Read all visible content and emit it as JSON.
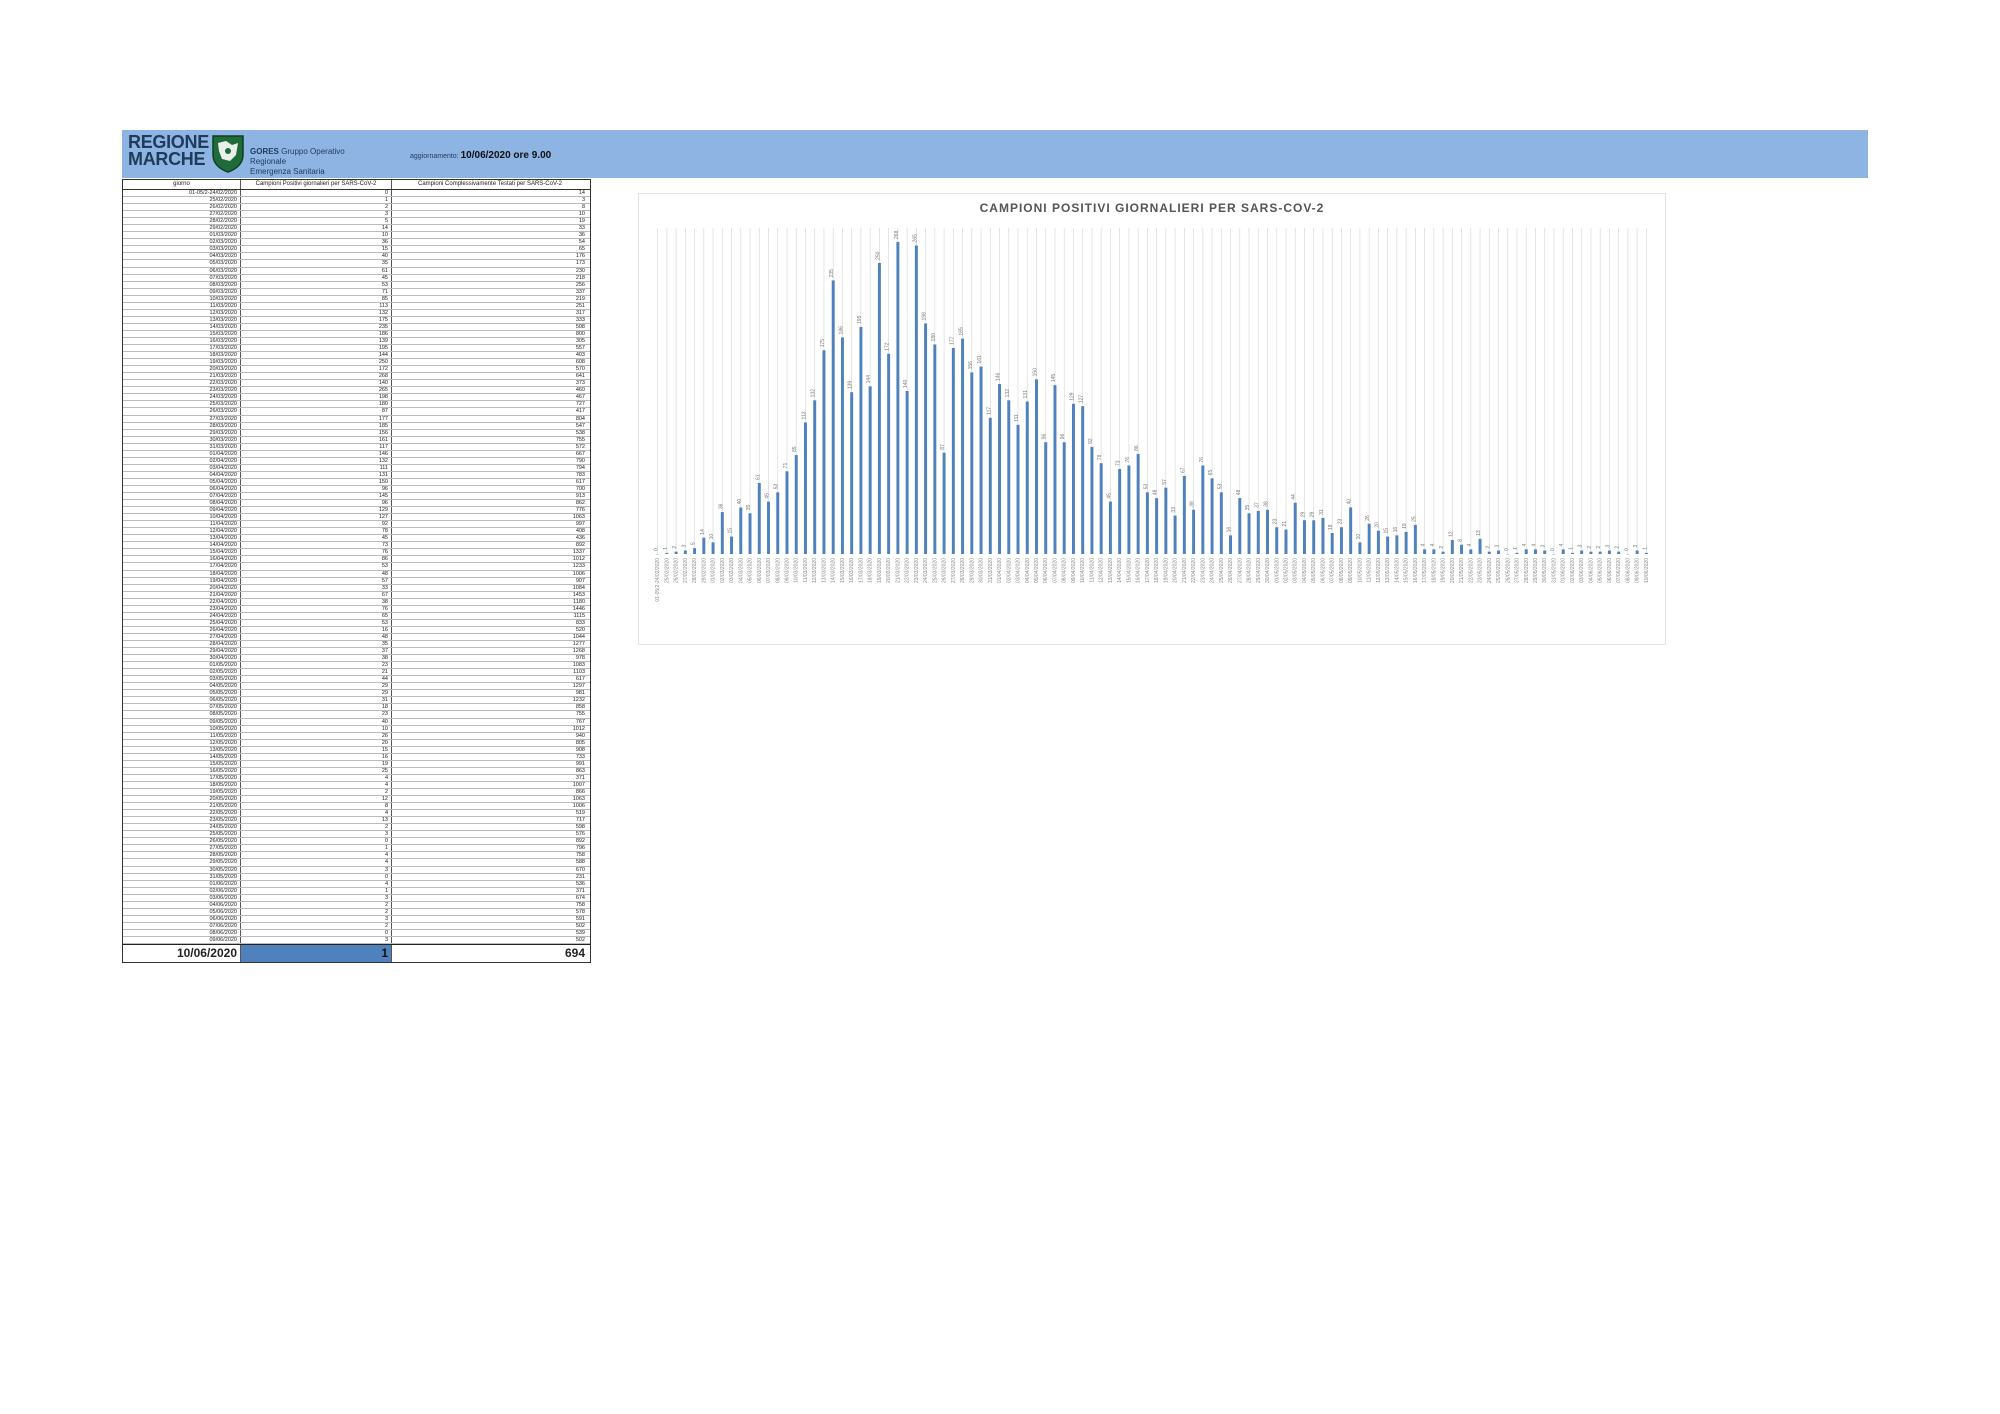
{
  "header": {
    "logo_text_line1": "REGIONE",
    "logo_text_line2": "MARCHE",
    "org_name": "GORES",
    "org_desc1": "Gruppo Operativo Regionale",
    "org_desc2": "Emergenza Sanitaria",
    "update_label": "aggiornamento:",
    "update_value": "10/06/2020 ore 9.00"
  },
  "table": {
    "headers": [
      "giorno",
      "Campioni Positivi giornalieri per SARS-CoV-2",
      "Campioni Complessivamente Testati per SARS-CoV-2"
    ],
    "rows": [
      [
        "01-05/2-24/02/2020",
        "0",
        "14"
      ],
      [
        "25/02/2020",
        "1",
        "3"
      ],
      [
        "26/02/2020",
        "2",
        "8"
      ],
      [
        "27/02/2020",
        "3",
        "10"
      ],
      [
        "28/02/2020",
        "5",
        "19"
      ],
      [
        "29/02/2020",
        "14",
        "33"
      ],
      [
        "01/03/2020",
        "10",
        "36"
      ],
      [
        "02/03/2020",
        "36",
        "54"
      ],
      [
        "03/03/2020",
        "15",
        "65"
      ],
      [
        "04/03/2020",
        "40",
        "176"
      ],
      [
        "05/03/2020",
        "35",
        "173"
      ],
      [
        "06/03/2020",
        "61",
        "230"
      ],
      [
        "07/03/2020",
        "45",
        "218"
      ],
      [
        "08/03/2020",
        "53",
        "256"
      ],
      [
        "09/03/2020",
        "71",
        "337"
      ],
      [
        "10/03/2020",
        "85",
        "219"
      ],
      [
        "11/03/2020",
        "113",
        "251"
      ],
      [
        "12/03/2020",
        "132",
        "317"
      ],
      [
        "13/03/2020",
        "175",
        "333"
      ],
      [
        "14/03/2020",
        "235",
        "508"
      ],
      [
        "15/03/2020",
        "186",
        "800"
      ],
      [
        "16/03/2020",
        "139",
        "305"
      ],
      [
        "17/03/2020",
        "195",
        "557"
      ],
      [
        "18/03/2020",
        "144",
        "403"
      ],
      [
        "19/03/2020",
        "250",
        "608"
      ],
      [
        "20/03/2020",
        "172",
        "570"
      ],
      [
        "21/03/2020",
        "268",
        "641"
      ],
      [
        "22/03/2020",
        "140",
        "373"
      ],
      [
        "23/03/2020",
        "265",
        "460"
      ],
      [
        "24/03/2020",
        "198",
        "467"
      ],
      [
        "25/03/2020",
        "180",
        "727"
      ],
      [
        "26/03/2020",
        "87",
        "417"
      ],
      [
        "27/03/2020",
        "177",
        "804"
      ],
      [
        "28/03/2020",
        "185",
        "547"
      ],
      [
        "29/03/2020",
        "156",
        "538"
      ],
      [
        "30/03/2020",
        "161",
        "755"
      ],
      [
        "31/03/2020",
        "117",
        "572"
      ],
      [
        "01/04/2020",
        "146",
        "667"
      ],
      [
        "02/04/2020",
        "132",
        "790"
      ],
      [
        "03/04/2020",
        "111",
        "794"
      ],
      [
        "04/04/2020",
        "131",
        "783"
      ],
      [
        "05/04/2020",
        "150",
        "617"
      ],
      [
        "06/04/2020",
        "96",
        "700"
      ],
      [
        "07/04/2020",
        "145",
        "913"
      ],
      [
        "08/04/2020",
        "96",
        "862"
      ],
      [
        "09/04/2020",
        "129",
        "776"
      ],
      [
        "10/04/2020",
        "127",
        "1063"
      ],
      [
        "11/04/2020",
        "92",
        "997"
      ],
      [
        "12/04/2020",
        "78",
        "408"
      ],
      [
        "13/04/2020",
        "45",
        "436"
      ],
      [
        "14/04/2020",
        "73",
        "892"
      ],
      [
        "15/04/2020",
        "76",
        "1337"
      ],
      [
        "16/04/2020",
        "86",
        "1012"
      ],
      [
        "17/04/2020",
        "53",
        "1233"
      ],
      [
        "18/04/2020",
        "48",
        "1006"
      ],
      [
        "19/04/2020",
        "57",
        "907"
      ],
      [
        "20/04/2020",
        "33",
        "1084"
      ],
      [
        "21/04/2020",
        "67",
        "1453"
      ],
      [
        "22/04/2020",
        "38",
        "1180"
      ],
      [
        "23/04/2020",
        "76",
        "1446"
      ],
      [
        "24/04/2020",
        "65",
        "1115"
      ],
      [
        "25/04/2020",
        "53",
        "833"
      ],
      [
        "26/04/2020",
        "16",
        "520"
      ],
      [
        "27/04/2020",
        "48",
        "1044"
      ],
      [
        "28/04/2020",
        "35",
        "1277"
      ],
      [
        "29/04/2020",
        "37",
        "1268"
      ],
      [
        "30/04/2020",
        "38",
        "978"
      ],
      [
        "01/05/2020",
        "23",
        "1083"
      ],
      [
        "02/05/2020",
        "21",
        "1103"
      ],
      [
        "03/05/2020",
        "44",
        "617"
      ],
      [
        "04/05/2020",
        "29",
        "1297"
      ],
      [
        "05/05/2020",
        "29",
        "981"
      ],
      [
        "06/05/2020",
        "31",
        "1232"
      ],
      [
        "07/05/2020",
        "18",
        "858"
      ],
      [
        "08/05/2020",
        "23",
        "755"
      ],
      [
        "09/05/2020",
        "40",
        "767"
      ],
      [
        "10/05/2020",
        "10",
        "1012"
      ],
      [
        "11/05/2020",
        "26",
        "940"
      ],
      [
        "12/05/2020",
        "20",
        "805"
      ],
      [
        "13/05/2020",
        "15",
        "908"
      ],
      [
        "14/05/2020",
        "16",
        "733"
      ],
      [
        "15/05/2020",
        "19",
        "991"
      ],
      [
        "16/05/2020",
        "25",
        "863"
      ],
      [
        "17/05/2020",
        "4",
        "371"
      ],
      [
        "18/05/2020",
        "4",
        "1007"
      ],
      [
        "19/05/2020",
        "2",
        "866"
      ],
      [
        "20/05/2020",
        "12",
        "1063"
      ],
      [
        "21/05/2020",
        "8",
        "1006"
      ],
      [
        "22/05/2020",
        "4",
        "519"
      ],
      [
        "23/05/2020",
        "13",
        "717"
      ],
      [
        "24/05/2020",
        "2",
        "598"
      ],
      [
        "25/05/2020",
        "3",
        "576"
      ],
      [
        "26/05/2020",
        "0",
        "892"
      ],
      [
        "27/05/2020",
        "1",
        "796"
      ],
      [
        "28/05/2020",
        "4",
        "758"
      ],
      [
        "29/05/2020",
        "4",
        "588"
      ],
      [
        "30/05/2020",
        "3",
        "670"
      ],
      [
        "31/05/2020",
        "0",
        "231"
      ],
      [
        "01/06/2020",
        "4",
        "536"
      ],
      [
        "02/06/2020",
        "1",
        "371"
      ],
      [
        "03/06/2020",
        "3",
        "674"
      ],
      [
        "04/06/2020",
        "2",
        "758"
      ],
      [
        "05/06/2020",
        "2",
        "578"
      ],
      [
        "06/06/2020",
        "3",
        "591"
      ],
      [
        "07/06/2020",
        "2",
        "502"
      ],
      [
        "08/06/2020",
        "0",
        "539"
      ],
      [
        "09/06/2020",
        "3",
        "502"
      ]
    ],
    "total_date": "10/06/2020",
    "total_positive": "1",
    "total_tested": "694"
  },
  "chart_data": {
    "type": "bar",
    "title": "CAMPIONI POSITIVI GIORNALIERI PER SARS-COV-2",
    "xlabel": "",
    "ylabel": "",
    "grid": "vertical",
    "color": "#4f81bd",
    "categories": [
      "01-05/2-24/02/2020",
      "25/02/2020",
      "26/02/2020",
      "27/02/2020",
      "28/02/2020",
      "29/02/2020",
      "01/03/2020",
      "02/03/2020",
      "03/03/2020",
      "04/03/2020",
      "05/03/2020",
      "06/03/2020",
      "07/03/2020",
      "08/03/2020",
      "09/03/2020",
      "10/03/2020",
      "11/03/2020",
      "12/03/2020",
      "13/03/2020",
      "14/03/2020",
      "15/03/2020",
      "16/03/2020",
      "17/03/2020",
      "18/03/2020",
      "19/03/2020",
      "20/03/2020",
      "21/03/2020",
      "22/03/2020",
      "23/03/2020",
      "24/03/2020",
      "25/03/2020",
      "26/03/2020",
      "27/03/2020",
      "28/03/2020",
      "29/03/2020",
      "30/03/2020",
      "31/03/2020",
      "01/04/2020",
      "02/04/2020",
      "03/04/2020",
      "04/04/2020",
      "05/04/2020",
      "06/04/2020",
      "07/04/2020",
      "08/04/2020",
      "09/04/2020",
      "10/04/2020",
      "11/04/2020",
      "12/04/2020",
      "13/04/2020",
      "14/04/2020",
      "15/04/2020",
      "16/04/2020",
      "17/04/2020",
      "18/04/2020",
      "19/04/2020",
      "20/04/2020",
      "21/04/2020",
      "22/04/2020",
      "23/04/2020",
      "24/04/2020",
      "25/04/2020",
      "26/04/2020",
      "27/04/2020",
      "28/04/2020",
      "29/04/2020",
      "30/04/2020",
      "01/05/2020",
      "02/05/2020",
      "03/05/2020",
      "04/05/2020",
      "05/05/2020",
      "06/05/2020",
      "07/05/2020",
      "08/05/2020",
      "09/05/2020",
      "10/05/2020",
      "11/05/2020",
      "12/05/2020",
      "13/05/2020",
      "14/05/2020",
      "15/05/2020",
      "16/05/2020",
      "17/05/2020",
      "18/05/2020",
      "19/05/2020",
      "20/05/2020",
      "21/05/2020",
      "22/05/2020",
      "23/05/2020",
      "24/05/2020",
      "25/05/2020",
      "26/05/2020",
      "27/05/2020",
      "28/05/2020",
      "29/05/2020",
      "30/05/2020",
      "31/05/2020",
      "01/06/2020",
      "02/06/2020",
      "03/06/2020",
      "04/06/2020",
      "05/06/2020",
      "06/06/2020",
      "07/06/2020",
      "08/06/2020",
      "09/06/2020",
      "10/06/2020"
    ],
    "values": [
      0,
      1,
      2,
      3,
      5,
      14,
      10,
      36,
      15,
      40,
      35,
      61,
      45,
      53,
      71,
      85,
      113,
      132,
      175,
      235,
      186,
      139,
      195,
      144,
      250,
      172,
      268,
      140,
      265,
      198,
      180,
      87,
      177,
      185,
      156,
      161,
      117,
      146,
      132,
      111,
      131,
      150,
      96,
      145,
      96,
      129,
      127,
      92,
      78,
      45,
      73,
      76,
      86,
      53,
      48,
      57,
      33,
      67,
      38,
      76,
      65,
      53,
      16,
      48,
      35,
      37,
      38,
      23,
      21,
      44,
      29,
      29,
      31,
      18,
      23,
      40,
      10,
      26,
      20,
      15,
      16,
      19,
      25,
      4,
      4,
      2,
      12,
      8,
      4,
      13,
      2,
      3,
      0,
      1,
      4,
      4,
      3,
      0,
      4,
      1,
      3,
      2,
      2,
      3,
      2,
      0,
      3,
      1
    ],
    "ylim": [
      0,
      280
    ]
  }
}
